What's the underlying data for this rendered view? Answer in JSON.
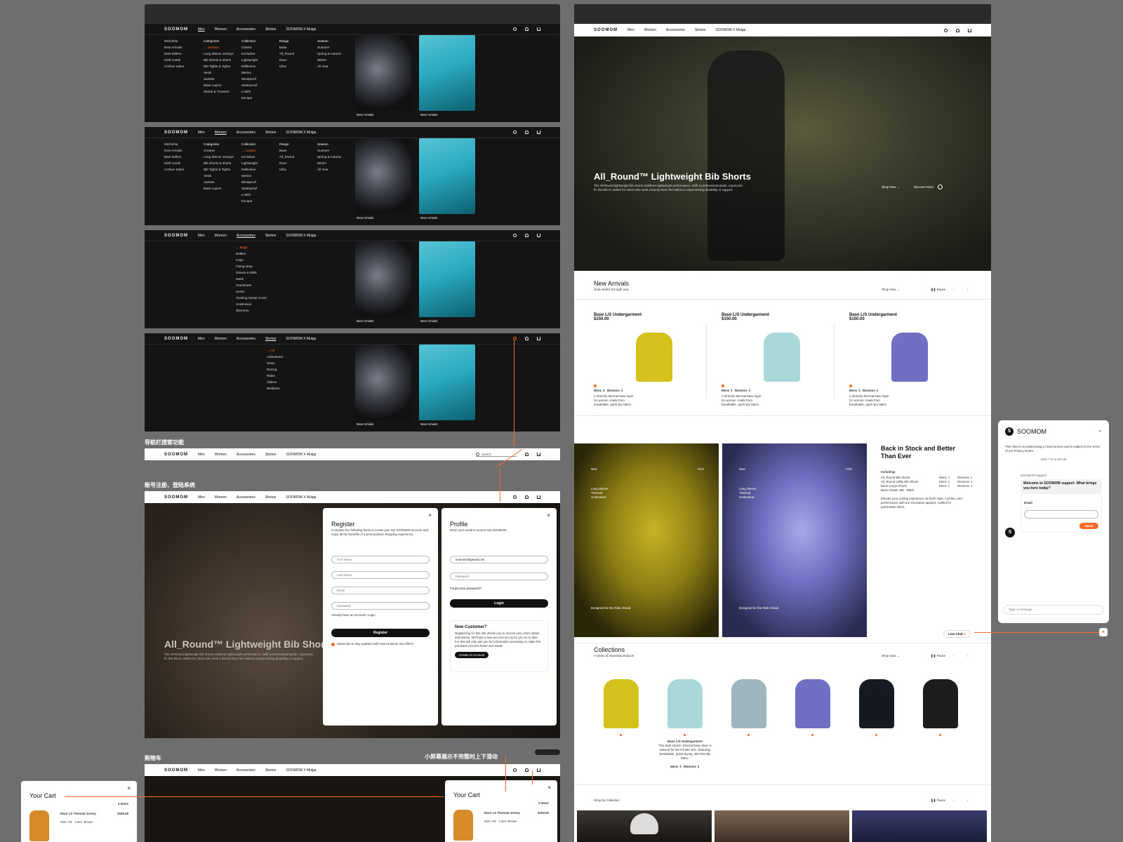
{
  "nav": {
    "logo": "SOOMOM",
    "men": "Men",
    "women": "Women",
    "accessories": "Accessories",
    "stories": "Stories",
    "collab": "SOOMOM X Mulga"
  },
  "mega1": {
    "col1": [
      "Michichta",
      "New Arrivals",
      "Best Sellers",
      "eGift Cards",
      "Archive Sales"
    ],
    "col2": [
      "Categories",
      "→ Jerseys",
      "Long Sleeve Jerseys",
      "Bib Shorts & shorts",
      "Bib Tights & Tights",
      "Vests",
      "Jackets",
      "Base Layers",
      "Shorts & Trousers"
    ],
    "col3": [
      "Collection",
      "Classic",
      "Exclusive",
      "Lightweight",
      "Reflective",
      "Merino",
      "Windproof",
      "Waterproof",
      "LAB/S",
      "Escape"
    ],
    "col4": [
      "Range",
      "Base",
      "All_Round",
      "Race",
      "Ultra"
    ],
    "col5": [
      "Season",
      "Summer",
      "Spring & Autumn",
      "Winter",
      "All Year"
    ]
  },
  "mega2": {
    "col1": [
      "Michichta",
      "New Arrivals",
      "Best Sellers",
      "eGift Cards",
      "Archive Sales"
    ],
    "col2": [
      "Categories",
      "Jerseys",
      "Long Sleeve Jerseys",
      "Bib Shorts & shorts",
      "Bib Tights & Tights",
      "Vests",
      "Jackets",
      "Base Layers"
    ],
    "col3": [
      "Collection",
      "→ Classic",
      "Exclusive",
      "Lightweight",
      "Reflective",
      "Merino",
      "Windproof",
      "Waterproof",
      "LAB/S",
      "Escape"
    ],
    "col4": [
      "Range",
      "Base",
      "All_Round",
      "Race",
      "Ultra"
    ],
    "col5": [
      "Season",
      "Summer",
      "Spring & Autumn",
      "Winter",
      "All Year"
    ]
  },
  "mega3": {
    "col": [
      "→ Bags",
      "Bottles",
      "Caps",
      "Fixing strap",
      "Gloves & Mitts",
      "Mask",
      "Overshoes",
      "Socks",
      "Training Sweat Cover",
      "Underwear",
      "Warmers"
    ]
  },
  "mega4": {
    "col": [
      "→ All",
      "Adventures",
      "News",
      "Racing",
      "Rides",
      "Videos",
      "Wellness"
    ]
  },
  "thumb_caption": "New Arrivals",
  "labels": {
    "search": "导航栏搜索功能",
    "account": "账号注册、登陆系统",
    "cart": "购物车",
    "scroll": "小屏幕展示不完整时上下滑动"
  },
  "search_placeholder": "Search",
  "hero": {
    "title": "All_Round™ Lightweight Bib Shorts",
    "desc": "The All-Round lightweight bib shorts redefines lightweight performance. With a professional-grade, ergonomic fit, this bib is crafted for riders who seek a barely-there feel without compromising durability or support.",
    "shop": "Shop Now →",
    "discover": "Discover More"
  },
  "register": {
    "title": "Register",
    "desc": "Complete the following fields to create your My SOOMOM account and enjoy all the benefits of a personalized shopping experience.",
    "first": "First Name",
    "last": "Last Name",
    "email": "Email",
    "password": "Password",
    "already": "Already have an account? Login",
    "button": "Register",
    "subscribe": "Subscribe to stay updated with new products and offers!"
  },
  "profile": {
    "title": "Profile",
    "desc": "Enter your email to access My SOOMOM",
    "email_value": "soomom@gmail.com",
    "password": "Password",
    "forgot": "Forgot your password?",
    "login": "Login",
    "new_title": "New Customer?",
    "new_desc": "Registering for this site allows you to access your order status and history. We'll get a new account set up for you in no time. For this will only ask you for information necessary to make the purchase process faster and easier.",
    "create": "Create An Account"
  },
  "cart": {
    "title": "Your Cart",
    "count": "3 Items",
    "item": "Race LS Thermal Jersey",
    "price": "$160.00",
    "size_label": "Size:",
    "size": "XS",
    "color_label": "Color:",
    "color": "Brown"
  },
  "new_arrivals": {
    "title": "New Arrivals",
    "sub": "Grab what's hot right now",
    "shop": "Shop Now →",
    "pause": "Pause",
    "products": [
      {
        "name": "Base L/S Undergarment",
        "price": "$150.00",
        "color": "#d4c11c",
        "desc": "A stretchy thermal base layer for women, made from breathable, quick-dry fabric."
      },
      {
        "name": "Base L/S Undergarment",
        "price": "$150.00",
        "color": "#a8d8d8",
        "desc": "A stretchy thermal base layer for women, made from breathable, quick-dry fabric."
      },
      {
        "name": "Base L/S Undergarment",
        "price": "$150.00",
        "color": "#6f70c4",
        "desc": "A stretchy thermal base layer for women, made from breathable, quick-dry fabric."
      }
    ],
    "mens": "Mens ⇩",
    "womens": "Womens ⇩"
  },
  "back_in_stock": {
    "title": "Back in Stock and Better Than Ever",
    "including": "Including:",
    "items": [
      "All_Round Bib Shorts",
      "All_Round Utility Bib Shorts",
      "Base Cargo Shorts",
      "Base Classic Bib - Black"
    ],
    "mens": "Mens ⇩",
    "womens": "Womens ⇩",
    "desc": "Elevate your cycling experience as fresh style, comfort, and performance with our innovative apparel, crafted for passionate riders.",
    "panel_new": "New",
    "panel_size": "XXS",
    "panel_a_lines": [
      "Long Sleeve",
      "Thermal",
      "Underwear"
    ],
    "panel_designed": "Designed for the Ride Ahead"
  },
  "collections": {
    "title": "Collections",
    "sub": "A series of essential products",
    "shop": "Shop Now →",
    "pause": "Pause",
    "colors": [
      "#d4c11c",
      "#a8d8d8",
      "#9fb6bf",
      "#6f70c4",
      "#151a22",
      "#1c1c1c"
    ],
    "caption_name": "Base L/S Undergarment",
    "caption_desc": "This high-stretch, thermal base layer is tailored for the female form, featuring breathable, quick-drying, skin-friendly fabric.",
    "mens": "Mens ⇩",
    "womens": "Womens ⇩"
  },
  "shop_by": {
    "title": "Shop by Collection",
    "pause": "Pause"
  },
  "chat": {
    "brand": "SOOMOM",
    "note": "This chat is recorded using a cloud service and is subject to the terms of our Privacy Notice.",
    "time": "April 7 at 11:48 AM",
    "agent": "SOOMOM Support",
    "greeting": "Welcome to SOOMOM support. What brings you here today?",
    "email": "Email",
    "send": "Send",
    "placeholder": "Type a message",
    "live": "Live Chat"
  },
  "accent": "#ff6a2a"
}
